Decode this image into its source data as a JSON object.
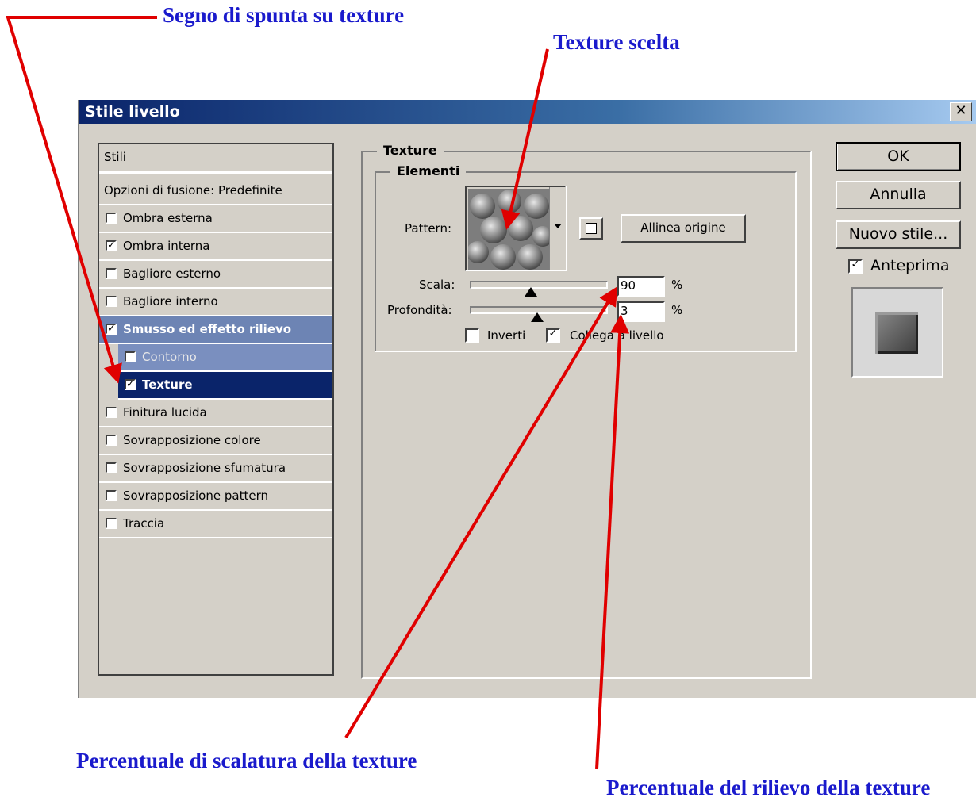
{
  "annotations": {
    "check_texture": "Segno di spunta su texture",
    "chosen_texture": "Texture scelta",
    "scale_percent": "Percentuale di scalatura della texture",
    "depth_percent": "Percentuale del rilievo della texture"
  },
  "dialog": {
    "title": "Stile livello",
    "close_glyph": "✕"
  },
  "styles": {
    "header": "Stili",
    "blend_options": "Opzioni di fusione: Predefinite",
    "items": [
      {
        "label": "Ombra esterna",
        "checked": false
      },
      {
        "label": "Ombra interna",
        "checked": true
      },
      {
        "label": "Bagliore esterno",
        "checked": false
      },
      {
        "label": "Bagliore interno",
        "checked": false
      },
      {
        "label": "Smusso ed effetto rilievo",
        "checked": true
      },
      {
        "label": "Contorno",
        "checked": false
      },
      {
        "label": "Texture",
        "checked": true
      },
      {
        "label": "Finitura lucida",
        "checked": false
      },
      {
        "label": "Sovrapposizione colore",
        "checked": false
      },
      {
        "label": "Sovrapposizione sfumatura",
        "checked": false
      },
      {
        "label": "Sovrapposizione pattern",
        "checked": false
      },
      {
        "label": "Traccia",
        "checked": false
      }
    ]
  },
  "texture": {
    "group_title": "Texture",
    "elements_title": "Elementi",
    "pattern_label": "Pattern:",
    "snap_button": "Allinea origine",
    "scale_label": "Scala:",
    "scale_value": "90",
    "depth_label": "Profondità:",
    "depth_value": "3",
    "percent": "%",
    "invert_label": "Inverti",
    "invert_checked": false,
    "link_label": "Collega a livello",
    "link_checked": true,
    "scale_level": 0.45,
    "depth_level": 0.5
  },
  "buttons": {
    "ok": "OK",
    "cancel": "Annulla",
    "new_style": "Nuovo stile...",
    "preview_label": "Anteprima",
    "preview_checked": true
  },
  "colors": {
    "annotation": "#1a1acc",
    "arrow": "#e00000",
    "title_bar": "#0a246a",
    "dialog_bg": "#d4d0c8"
  }
}
